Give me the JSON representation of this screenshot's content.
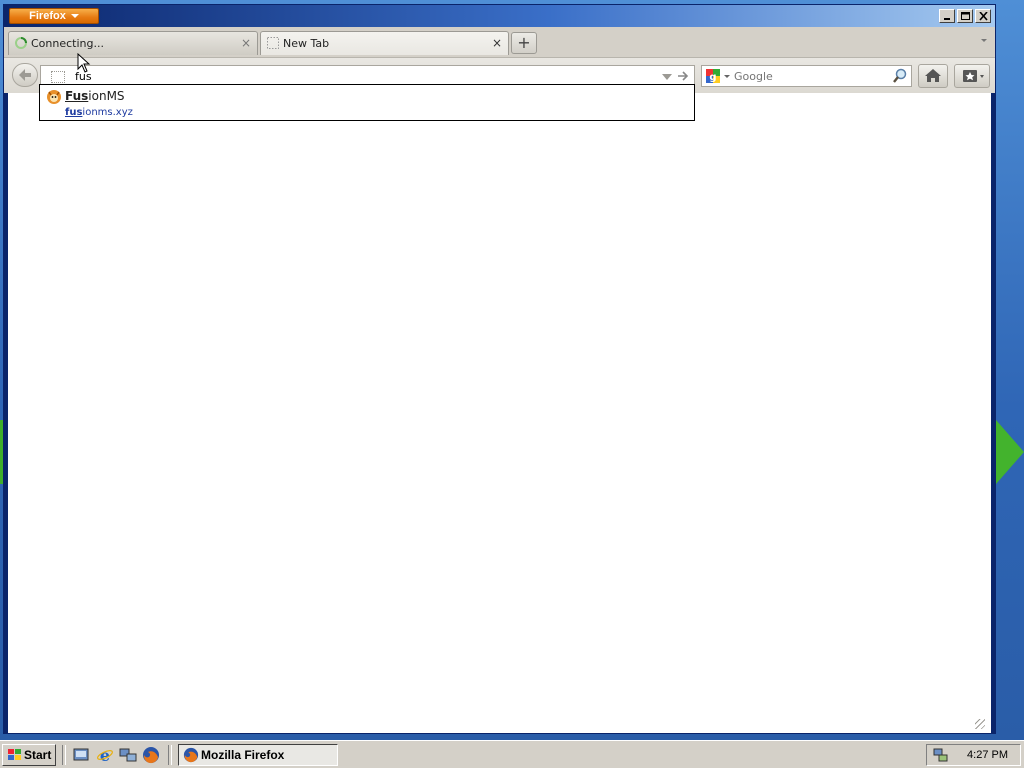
{
  "window": {
    "app_button_label": "Firefox"
  },
  "tabs": [
    {
      "label": "Connecting...",
      "close": "×"
    },
    {
      "label": "New Tab",
      "close": "×"
    }
  ],
  "toolbar": {
    "new_tab": "+",
    "url_value": "fus",
    "search_placeholder": "Google"
  },
  "autocomplete": {
    "title_match": "Fus",
    "title_rest": "ionMS",
    "url_match": "fus",
    "url_rest": "ionms.xyz"
  },
  "taskbar": {
    "start_label": "Start",
    "task_label": "Mozilla Firefox",
    "clock": "4:27 PM"
  },
  "colors": {
    "firefox_orange": "#e67a12",
    "title_blue": "#0a246a",
    "url_blue": "#1e3ba0"
  },
  "icons": [
    "firefox-menu-caret",
    "minimize-icon",
    "maximize-icon",
    "close-icon",
    "loading-spinner-icon",
    "blank-page-icon",
    "back-arrow-icon",
    "go-arrow-icon",
    "google-icon",
    "magnifier-icon",
    "home-icon",
    "bookmarks-icon",
    "mozilla-fox-icon",
    "windows-flag-icon",
    "show-desktop-icon",
    "ie-icon",
    "network-icon",
    "firefox-icon",
    "tray-network-icon"
  ]
}
